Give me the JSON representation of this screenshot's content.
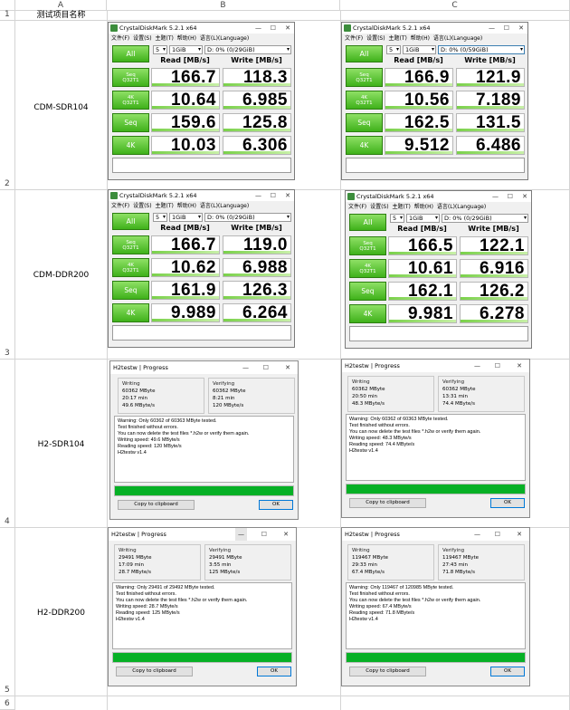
{
  "sheet": {
    "columns": [
      "A",
      "B",
      "C"
    ],
    "rows": [
      "1",
      "2",
      "3",
      "4",
      "5",
      "6"
    ],
    "header_cell": "测试项目名称",
    "row_labels": [
      "CDM-SDR104",
      "CDM-DDR200",
      "H2-SDR104",
      "H2-DDR200"
    ]
  },
  "cdm": {
    "title": "CrystalDiskMark 5.2.1 x64",
    "menu": [
      "文件(F)",
      "设置(S)",
      "主题(T)",
      "帮助(H)",
      "语言(L)(Language)"
    ],
    "count": "5",
    "size": "1GiB",
    "all_label": "All",
    "read_header": "Read [MB/s]",
    "write_header": "Write [MB/s]",
    "test_labels": [
      [
        "Seq",
        "Q32T1"
      ],
      [
        "4K",
        "Q32T1"
      ],
      [
        "Seq",
        ""
      ],
      [
        "4K",
        ""
      ]
    ],
    "windows": [
      {
        "drive": "D: 0% (0/29GiB)",
        "read": [
          "166.7",
          "10.64",
          "159.6",
          "10.03"
        ],
        "write": [
          "118.3",
          "6.985",
          "125.8",
          "6.306"
        ]
      },
      {
        "drive": "D: 0% (0/59GiB)",
        "read": [
          "166.9",
          "10.56",
          "162.5",
          "9.512"
        ],
        "write": [
          "121.9",
          "7.189",
          "131.5",
          "6.486"
        ]
      },
      {
        "drive": "D: 0% (0/29GiB)",
        "read": [
          "166.7",
          "10.62",
          "161.9",
          "9.989"
        ],
        "write": [
          "119.0",
          "6.988",
          "126.3",
          "6.264"
        ]
      },
      {
        "drive": "D: 0% (0/29GiB)",
        "read": [
          "166.5",
          "10.61",
          "162.1",
          "9.981"
        ],
        "write": [
          "122.1",
          "6.916",
          "126.2",
          "6.278"
        ]
      }
    ]
  },
  "h2": {
    "title": "H2testw | Progress",
    "writing_label": "Writing",
    "verifying_label": "Verifying",
    "copy_label": "Copy to clipboard",
    "ok_label": "OK",
    "windows": [
      {
        "w": [
          "60362 MByte",
          "20:17 min",
          "49.6 MByte/s"
        ],
        "v": [
          "60362 MByte",
          "8:21 min",
          "120 MByte/s"
        ],
        "log": [
          "Warning: Only 60362 of 60363 MByte tested.",
          "Test finished without errors.",
          "You can now delete the test files *.h2w or verify them again.",
          "Writing speed: 49.6 MByte/s",
          "Reading speed: 120 MByte/s",
          "H2testw v1.4"
        ]
      },
      {
        "w": [
          "60362 MByte",
          "20:50 min",
          "48.3 MByte/s"
        ],
        "v": [
          "60362 MByte",
          "13:31 min",
          "74.4 MByte/s"
        ],
        "log": [
          "Warning: Only 60362 of 60363 MByte tested.",
          "Test finished without errors.",
          "You can now delete the test files *.h2w or verify them again.",
          "Writing speed: 48.3 MByte/s",
          "Reading speed: 74.4 MByte/s",
          "H2testw v1.4"
        ]
      },
      {
        "w": [
          "29491 MByte",
          "17:09 min",
          "28.7 MByte/s"
        ],
        "v": [
          "29491 MByte",
          "3:55 min",
          "125 MByte/s"
        ],
        "log": [
          "Warning: Only 29491 of 29492 MByte tested.",
          "Test finished without errors.",
          "You can now delete the test files *.h2w or verify them again.",
          "Writing speed: 28.7 MByte/s",
          "Reading speed: 125 MByte/s",
          "H2testw v1.4"
        ]
      },
      {
        "w": [
          "119467 MByte",
          "29:33 min",
          "67.4 MByte/s"
        ],
        "v": [
          "119467 MByte",
          "27:43 min",
          "71.8 MByte/s"
        ],
        "log": [
          "Warning: Only 119467 of 120985 MByte tested.",
          "Test finished without errors.",
          "You can now delete the test files *.h2w or verify them again.",
          "Writing speed: 67.4 MByte/s",
          "Reading speed: 71.8 MByte/s",
          "H2testw v1.4"
        ]
      }
    ]
  }
}
